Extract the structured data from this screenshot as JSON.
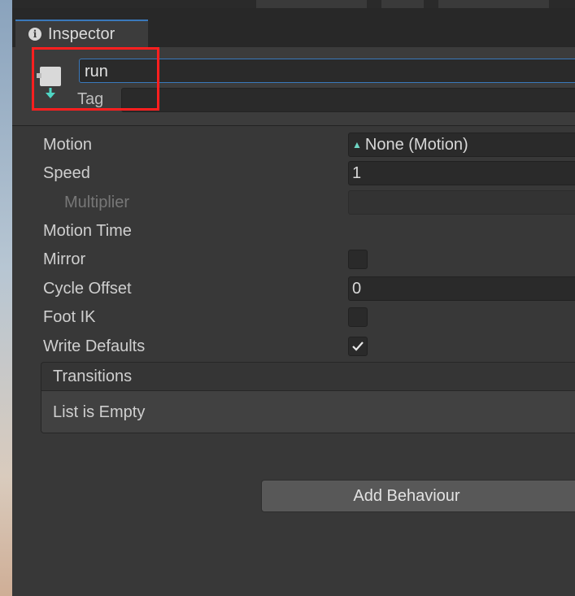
{
  "tab": {
    "title": "Inspector"
  },
  "header": {
    "name_value": "run",
    "tag_label": "Tag",
    "tag_value": ""
  },
  "properties": {
    "motion": {
      "label": "Motion",
      "value": "None (Motion)"
    },
    "speed": {
      "label": "Speed",
      "value": "1"
    },
    "multiplier": {
      "label": "Multiplier"
    },
    "motion_time": {
      "label": "Motion Time"
    },
    "mirror": {
      "label": "Mirror",
      "checked": false
    },
    "cycle_offset": {
      "label": "Cycle Offset",
      "value": "0"
    },
    "foot_ik": {
      "label": "Foot IK",
      "checked": false
    },
    "write_defaults": {
      "label": "Write Defaults",
      "checked": true
    }
  },
  "transitions": {
    "header": "Transitions",
    "empty_text": "List is Empty"
  },
  "buttons": {
    "add_behaviour": "Add Behaviour"
  },
  "colors": {
    "accent": "#3a79bb",
    "highlight": "#ff1f1f",
    "motion_icon": "#6fd6c4"
  }
}
